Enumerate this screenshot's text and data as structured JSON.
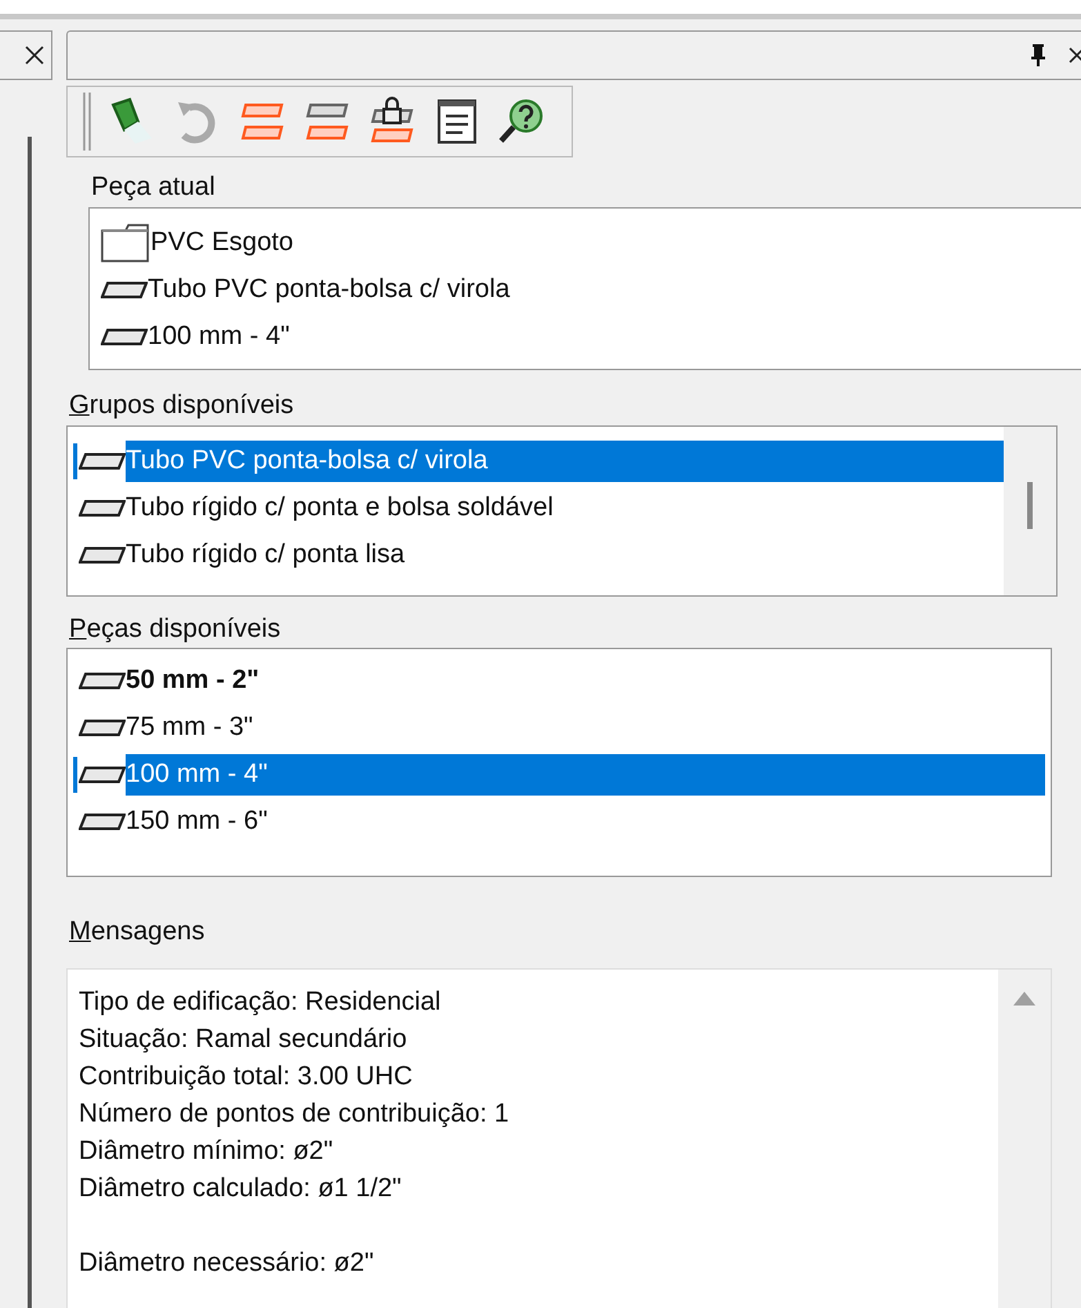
{
  "current_piece": {
    "label": "Peça atual",
    "underline_first": false,
    "items": [
      {
        "kind": "folder",
        "text": "PVC Esgoto"
      },
      {
        "kind": "tube",
        "text": "Tubo PVC ponta-bolsa c/ virola"
      },
      {
        "kind": "tube",
        "text": "100 mm - 4\""
      }
    ]
  },
  "groups": {
    "label": "Grupos disponíveis",
    "underline_first": true,
    "items": [
      {
        "kind": "tube",
        "text": "Tubo PVC ponta-bolsa c/ virola",
        "selected": true,
        "bold": false
      },
      {
        "kind": "tube",
        "text": "Tubo rígido c/ ponta e bolsa soldável",
        "selected": false,
        "bold": false
      },
      {
        "kind": "tube",
        "text": "Tubo rígido c/ ponta lisa",
        "selected": false,
        "bold": false
      }
    ]
  },
  "pieces": {
    "label": "Peças disponíveis",
    "underline_first": true,
    "items": [
      {
        "kind": "tube",
        "text": "50 mm - 2\"",
        "selected": false,
        "bold": true
      },
      {
        "kind": "tube",
        "text": "75 mm - 3\"",
        "selected": false,
        "bold": false
      },
      {
        "kind": "tube",
        "text": "100 mm - 4\"",
        "selected": true,
        "bold": false
      },
      {
        "kind": "tube",
        "text": "150 mm - 6\"",
        "selected": false,
        "bold": false
      }
    ]
  },
  "messages": {
    "label": "Mensagens",
    "underline_first": true,
    "blocks": [
      [
        "Tipo de edificação: Residencial",
        "Situação: Ramal secundário",
        "Contribuição total: 3.00 UHC",
        "Número de pontos de contribuição: 1",
        "Diâmetro mínimo: ø2\"",
        "Diâmetro calculado: ø1 1/2\""
      ],
      [
        "Diâmetro necessário: ø2\""
      ]
    ]
  }
}
